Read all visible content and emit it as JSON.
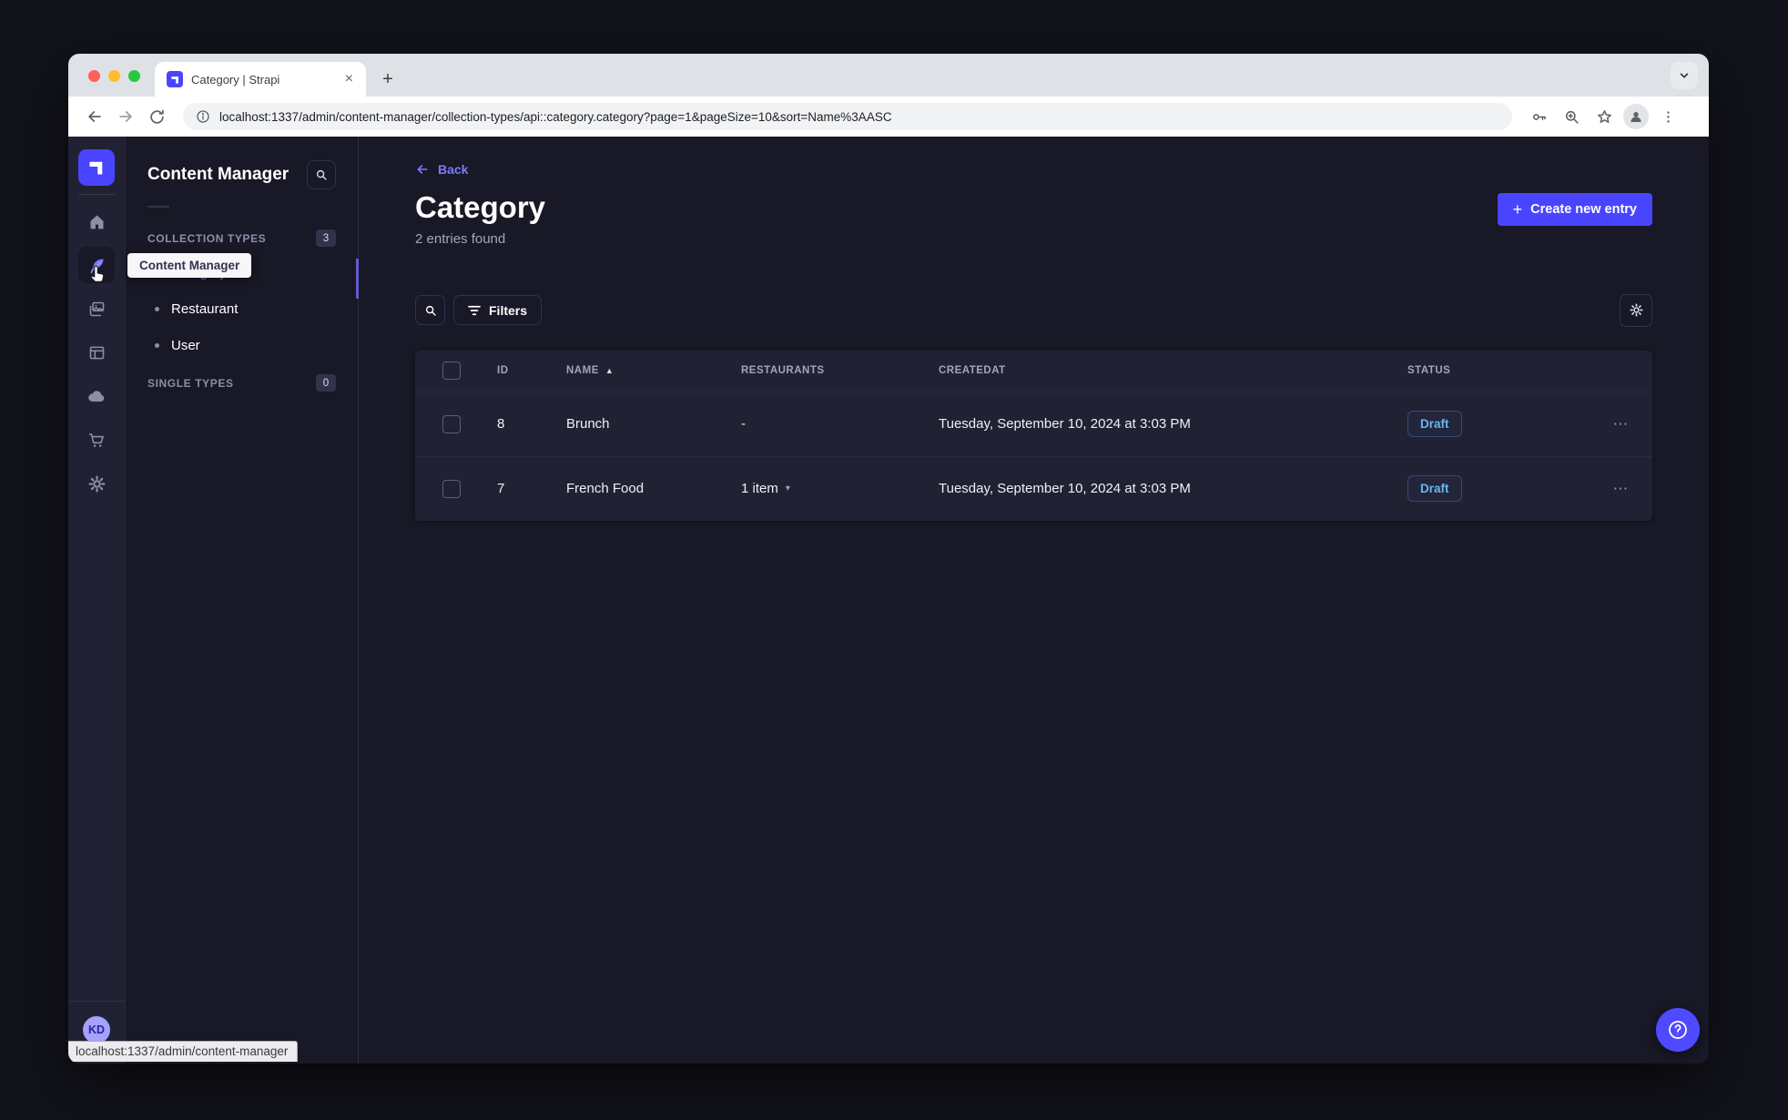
{
  "browser": {
    "tab_title": "Category | Strapi",
    "close_tab_glyph": "×",
    "new_tab_glyph": "+",
    "url": "localhost:1337/admin/content-manager/collection-types/api::category.category?page=1&pageSize=10&sort=Name%3AASC",
    "toolbar_icons": [
      "back-arrow",
      "forward-arrow",
      "reload",
      "site-info",
      "passwords-key",
      "zoom-magnifier",
      "bookmark-star",
      "profile-avatar",
      "menu-kebab"
    ]
  },
  "navbar": {
    "icons": [
      "home",
      "content-manager",
      "media-library",
      "content-type-builder",
      "cloud",
      "marketplace",
      "settings"
    ],
    "active_icon": "content-manager",
    "avatar_initials": "KD"
  },
  "subnav": {
    "title": "Content Manager",
    "tooltip": "Content Manager",
    "collection_types": {
      "label": "COLLECTION TYPES",
      "count": "3",
      "items": [
        {
          "label": "Category",
          "active": true
        },
        {
          "label": "Restaurant",
          "active": false
        },
        {
          "label": "User",
          "active": false
        }
      ]
    },
    "single_types": {
      "label": "SINGLE TYPES",
      "count": "0"
    }
  },
  "main": {
    "back_label": "Back",
    "title": "Category",
    "subtitle": "2 entries found",
    "create_button_label": "Create new entry",
    "filters_label": "Filters",
    "table": {
      "headers": {
        "id": "ID",
        "name": "NAME",
        "restaurants": "RESTAURANTS",
        "createdat": "CREATEDAT",
        "status": "STATUS"
      },
      "rows": [
        {
          "id": "8",
          "name": "Brunch",
          "restaurants": "-",
          "restaurants_dropdown": false,
          "createdat": "Tuesday, September 10, 2024 at 3:03 PM",
          "status": "Draft"
        },
        {
          "id": "7",
          "name": "French Food",
          "restaurants": "1 item",
          "restaurants_dropdown": true,
          "createdat": "Tuesday, September 10, 2024 at 3:03 PM",
          "status": "Draft"
        }
      ]
    }
  },
  "status_bar_text": "localhost:1337/admin/content-manager",
  "colors": {
    "accent": "#4945ff",
    "link": "#7b79ff",
    "draft_text": "#66b7f1",
    "app_bg": "#181826",
    "panel_bg": "#212134"
  }
}
